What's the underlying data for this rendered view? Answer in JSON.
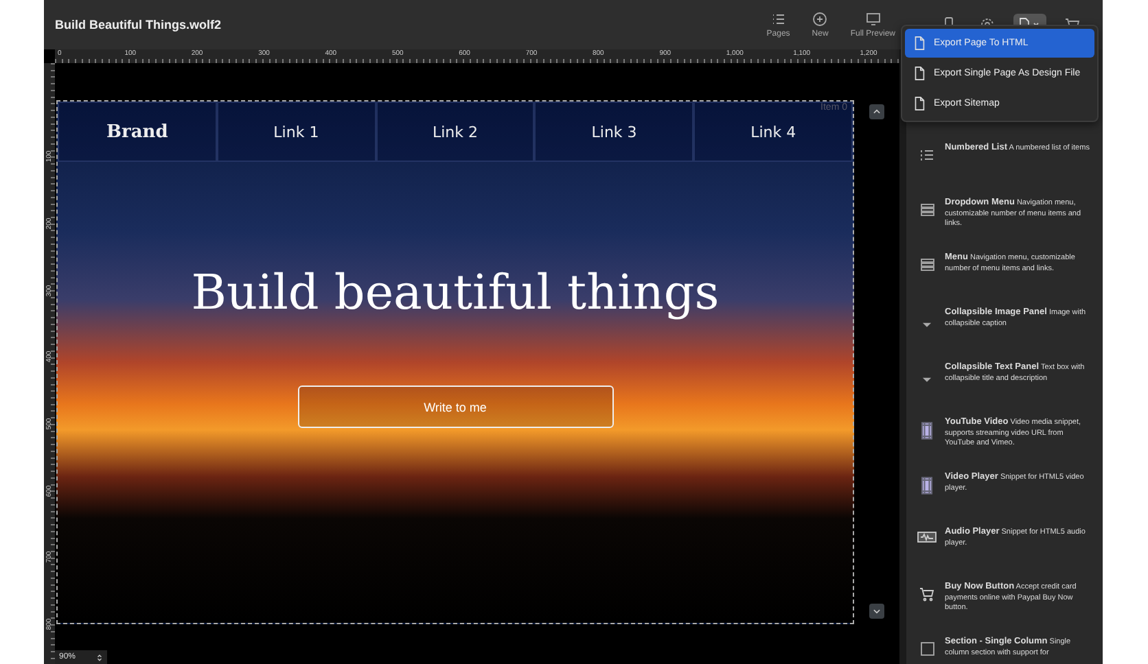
{
  "window": {
    "title": "Build Beautiful Things.wolf2"
  },
  "toolbar": {
    "buttons": [
      {
        "kind": "pages",
        "label": "Pages"
      },
      {
        "kind": "new",
        "label": "New"
      },
      {
        "kind": "preview",
        "label": "Full Preview"
      },
      {
        "kind": "phone"
      },
      {
        "kind": "gear"
      },
      {
        "kind": "export",
        "selected": true
      },
      {
        "kind": "cart"
      }
    ]
  },
  "export_menu": {
    "items": [
      {
        "label": "Export Page To HTML",
        "selected": true
      },
      {
        "label": "Export Single Page As Design File",
        "selected": false
      },
      {
        "label": "Export Sitemap",
        "selected": false
      }
    ]
  },
  "ruler": {
    "horizontal": [
      "0",
      "100",
      "200",
      "300",
      "400",
      "500",
      "600",
      "700",
      "800",
      "900",
      "1,000",
      "1,100",
      "1,200"
    ],
    "vertical": [
      "100",
      "200",
      "300",
      "400",
      "500",
      "600",
      "700",
      "800"
    ]
  },
  "canvas": {
    "item_label": "Item 0",
    "nav": {
      "brand": "Brand",
      "links": [
        "Link 1",
        "Link 2",
        "Link 3",
        "Link 4"
      ]
    },
    "heading": "Build beautiful things",
    "button": "Write to me"
  },
  "zoom": {
    "value": "90%"
  },
  "snippets": [
    {
      "kind": "numbered",
      "title": "Numbered List",
      "description": "A numbered list of items"
    },
    {
      "kind": "menu",
      "title": "Dropdown Menu",
      "description": "Navigation menu, customizable number of menu items and links."
    },
    {
      "kind": "menu",
      "title": "Menu",
      "description": "Navigation menu, customizable number of menu items and links."
    },
    {
      "kind": "collapse",
      "title": "Collapsible Image Panel",
      "description": "Image with collapsible caption"
    },
    {
      "kind": "collapse",
      "title": "Collapsible Text Panel",
      "description": "Text box with collapsible title and description"
    },
    {
      "kind": "film",
      "title": "YouTube Video",
      "description": "Video media snippet, supports streaming video URL from YouTube and Vimeo."
    },
    {
      "kind": "film",
      "title": "Video Player",
      "description": "Snippet for HTML5 video player."
    },
    {
      "kind": "audio",
      "title": "Audio Player",
      "description": "Snippet for HTML5 audio player."
    },
    {
      "kind": "cart",
      "title": "Buy Now Button",
      "description": "Accept credit card payments online with Paypal Buy Now button."
    },
    {
      "kind": "section",
      "title": "Section - Single Column",
      "description": "Single column section with support for"
    }
  ]
}
